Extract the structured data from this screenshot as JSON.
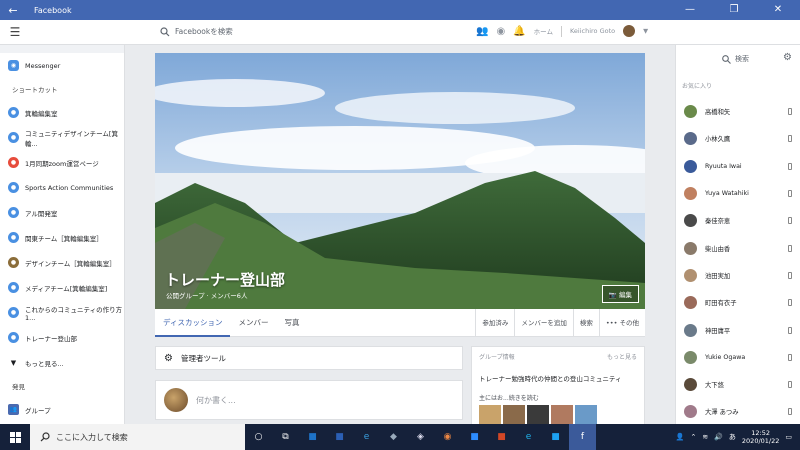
{
  "window": {
    "title": "Facebook",
    "back_glyph": "←",
    "minimize_glyph": "—",
    "restore_glyph": "❐",
    "close_glyph": "✕"
  },
  "topbar": {
    "search_placeholder": "Facebookを検索",
    "home_label": "ホーム",
    "user_name": "Keiichiro Goto"
  },
  "left_nav": {
    "messenger": "Messenger",
    "shortcuts_heading": "ショートカット",
    "shortcuts": [
      "箕輪編集室",
      "コミュニティデザインチーム[箕輪...",
      "1月同期zoom運営ページ",
      "Sports Action Communities",
      "アル開発室",
      "関東チーム［箕輪編集室］",
      "デザインチーム［箕輪編集室］",
      "メディアチーム[箕輪編集室]",
      "これからのコミュニティの作り方1...",
      "トレーナー登山部"
    ],
    "see_more": "もっと見る...",
    "discover_heading": "発見",
    "groups_label": "グループ"
  },
  "group": {
    "name": "トレーナー登山部",
    "meta": "公開グループ · メンバー6人",
    "edit_cover": "編集",
    "tabs": [
      "ディスカッション",
      "メンバー",
      "写真"
    ],
    "actions": [
      "参加済み",
      "メンバーを追加",
      "検索",
      "••• その他"
    ],
    "admin_tools": "管理者ツール",
    "composer_placeholder": "何か書く..."
  },
  "group_info": {
    "heading": "グループ情報",
    "see_more": "もっと見る",
    "description": "トレーナー勉強時代の仲間との登山コミュニティ",
    "read_more": "主にはお...続きを読む"
  },
  "right_panel": {
    "search_label": "検索",
    "favorites_heading": "お気に入り",
    "contacts": [
      "高橋和矢",
      "小林久鷹",
      "Ryuuta Iwai",
      "Yuya Watahiki",
      "秦佳奈恵",
      "柴山由香",
      "池田実加",
      "町田有衣子",
      "神田庸平",
      "Yukie Ogawa",
      "大下悠",
      "大澤 あつみ"
    ]
  },
  "taskbar": {
    "search_placeholder": "ここに入力して検索",
    "time": "12:52",
    "date": "2020/01/22",
    "ime": "あ"
  },
  "colors": {
    "brand": "#4267b2",
    "taskbar": "#15213a"
  }
}
